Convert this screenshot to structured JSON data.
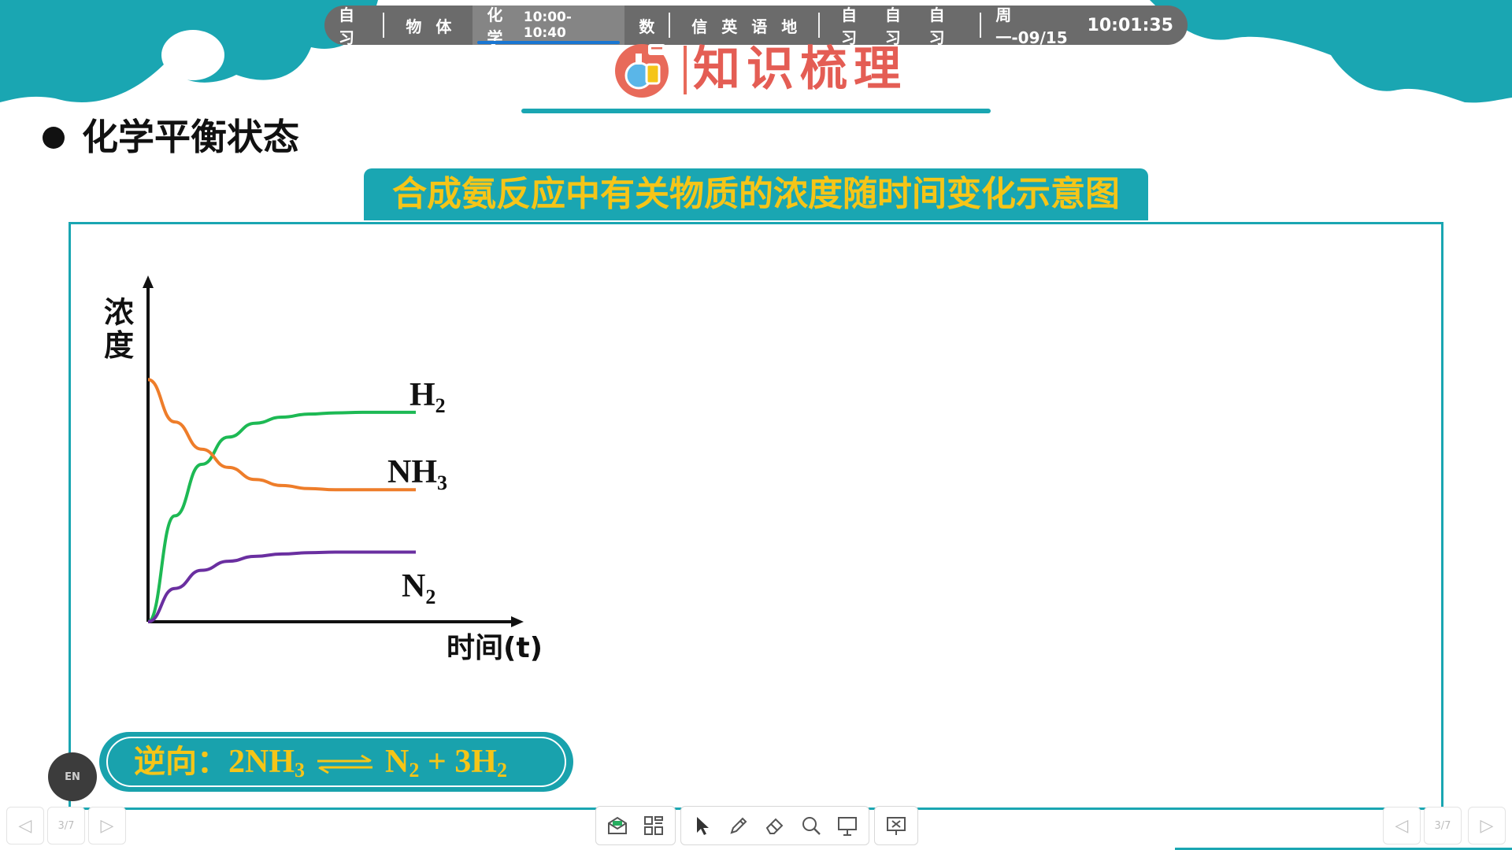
{
  "schedule": {
    "slots": [
      {
        "label": "自习"
      },
      {
        "label": "物"
      },
      {
        "label": "体"
      },
      {
        "label": "化学",
        "time": "10:00-10:40",
        "active": true
      },
      {
        "label": "数"
      },
      {
        "label": "信"
      },
      {
        "label": "英"
      },
      {
        "label": "语"
      },
      {
        "label": "地"
      },
      {
        "label": "自习"
      },
      {
        "label": "自习"
      },
      {
        "label": "自习"
      }
    ],
    "date": "周一-09/15",
    "clock": "10:01:35"
  },
  "header": {
    "title": "知识梳理",
    "icon": "chemistry-flask-icon"
  },
  "section": {
    "bullet": "●",
    "title": "化学平衡状态"
  },
  "figure": {
    "caption": "合成氨反应中有关物质的浓度随时间变化示意图"
  },
  "chart_data": {
    "type": "line",
    "xlabel": "时间(t)",
    "ylabel": "浓度",
    "x": [
      0,
      1,
      2,
      3,
      4,
      5,
      6,
      7,
      8,
      9,
      10
    ],
    "series": [
      {
        "name": "H2",
        "label_main": "H",
        "label_sub": "2",
        "color": "#1db954",
        "values": [
          0,
          1.75,
          2.6,
          3.05,
          3.28,
          3.38,
          3.43,
          3.45,
          3.46,
          3.46,
          3.46
        ]
      },
      {
        "name": "NH3",
        "label_main": "NH",
        "label_sub": "3",
        "color": "#ee7d2a",
        "values": [
          4.0,
          3.3,
          2.85,
          2.55,
          2.35,
          2.25,
          2.2,
          2.18,
          2.18,
          2.18,
          2.18
        ]
      },
      {
        "name": "N2",
        "label_main": "N",
        "label_sub": "2",
        "color": "#6a2fa0",
        "values": [
          0,
          0.55,
          0.85,
          1.0,
          1.08,
          1.12,
          1.14,
          1.15,
          1.15,
          1.15,
          1.15
        ]
      }
    ],
    "ylim": [
      0,
      5.2
    ],
    "xlim": [
      0,
      12.5
    ],
    "grid": false,
    "legend": "inline-right"
  },
  "reaction": {
    "prefix": "逆向：",
    "lhs_coef": "2",
    "lhs_main": "NH",
    "lhs_sub": "3",
    "rhs1_main": "N",
    "rhs1_sub": "2",
    "plus": "+",
    "rhs2_coef": "3",
    "rhs2_main": "H",
    "rhs2_sub": "2"
  },
  "lang_badge": "EN",
  "nav": {
    "prev_icon": "chevron-left-icon",
    "next_icon": "chevron-right-icon",
    "page": "3/7"
  },
  "toolbar": {
    "tools": [
      "envelope-icon",
      "grid-apps-icon",
      "cursor-arrow-icon",
      "pen-icon",
      "eraser-icon",
      "magnifier-icon",
      "whiteboard-icon",
      "exit-presentation-icon"
    ]
  },
  "colors": {
    "teal": "#1aa6b2",
    "caption_text": "#f5c518",
    "header_red": "#e45d54"
  }
}
